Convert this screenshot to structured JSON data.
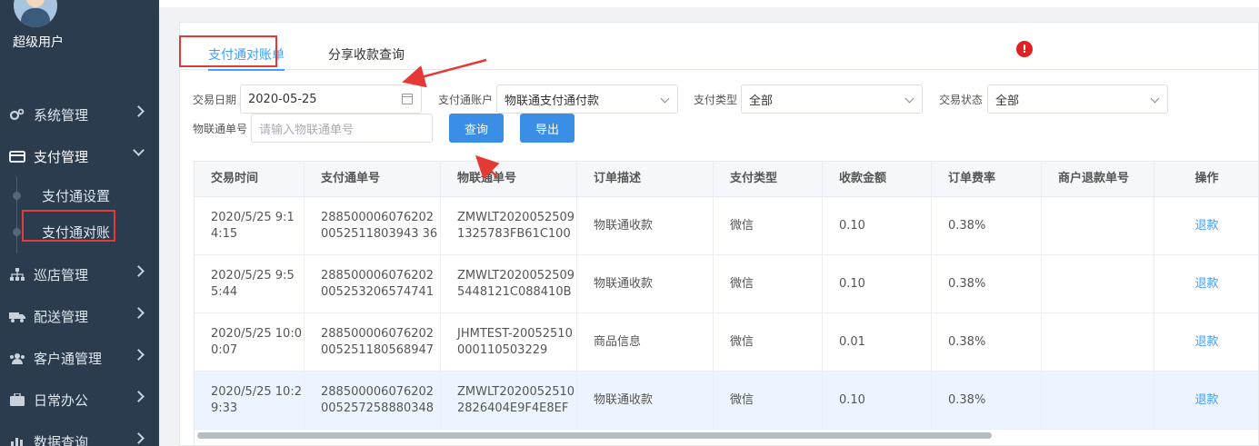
{
  "user": {
    "name": "超级用户"
  },
  "sidebar": {
    "items": [
      {
        "label": "系统管理",
        "icon": "gears-icon"
      },
      {
        "label": "支付管理",
        "icon": "card-icon"
      },
      {
        "label": "巡店管理",
        "icon": "sitemap-icon"
      },
      {
        "label": "配送管理",
        "icon": "truck-icon"
      },
      {
        "label": "客户通管理",
        "icon": "users-icon"
      },
      {
        "label": "日常办公",
        "icon": "briefcase-icon"
      },
      {
        "label": "数据查询",
        "icon": "bar-chart-icon"
      }
    ],
    "sub_items": [
      "支付通设置",
      "支付通对账"
    ]
  },
  "tabs": [
    "支付通对账单",
    "分享收款查询"
  ],
  "filters": {
    "date_label": "交易日期",
    "date_value": "2020-05-25",
    "account_label": "支付通账户",
    "account_value": "物联通支付通付款",
    "paytype_label": "支付类型",
    "paytype_value": "全部",
    "status_label": "交易状态",
    "status_value": "全部",
    "order_label": "物联通单号",
    "order_placeholder": "请输入物联通单号",
    "query_button": "查询",
    "export_button": "导出"
  },
  "table": {
    "columns": [
      "交易时间",
      "支付通单号",
      "物联通单号",
      "订单描述",
      "支付类型",
      "收款金额",
      "订单费率",
      "商户退款单号",
      "操作"
    ],
    "rows": [
      {
        "time": "2020/5/25 9:14:15",
        "pay_no": "2885000060762020052511803943 36",
        "wlt_no": "ZMWLT20200525091325783FB61C100",
        "desc": "物联通收款",
        "type": "微信",
        "amount": "0.10",
        "rate": "0.38%",
        "refund_no": "",
        "action": "退款"
      },
      {
        "time": "2020/5/25 9:55:44",
        "pay_no": "288500006076202005253206574741",
        "wlt_no": "ZMWLT20200525095448121C088410B",
        "desc": "物联通收款",
        "type": "微信",
        "amount": "0.10",
        "rate": "0.38%",
        "refund_no": "",
        "action": "退款"
      },
      {
        "time": "2020/5/25 10:00:07",
        "pay_no": "288500006076202005251180568947",
        "wlt_no": "JHMTEST-20052510000110503229",
        "desc": "商品信息",
        "type": "微信",
        "amount": "0.01",
        "rate": "0.38%",
        "refund_no": "",
        "action": "退款"
      },
      {
        "time": "2020/5/25 10:29:33",
        "pay_no": "288500006076202005257258880348",
        "wlt_no": "ZMWLT20200525102826404E9F4E8EF",
        "desc": "物联通收款",
        "type": "微信",
        "amount": "0.10",
        "rate": "0.38%",
        "refund_no": "",
        "action": "退款"
      }
    ]
  },
  "colors": {
    "sidebar_bg": "#2b3c4e",
    "accent": "#409eff",
    "annotation": "#e53935"
  }
}
